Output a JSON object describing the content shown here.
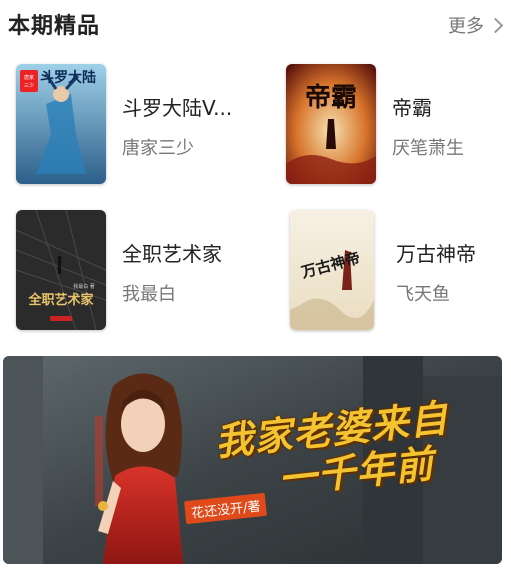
{
  "section": {
    "title": "本期精品",
    "more_label": "更多"
  },
  "books": [
    {
      "title": "斗罗大陆V...",
      "author": "唐家三少",
      "cover_text": "斗罗大陆",
      "cover_badge": "唐家三少"
    },
    {
      "title": "帝霸",
      "author": "厌笔萧生",
      "cover_text": "帝霸"
    },
    {
      "title": "全职艺术家",
      "author": "我最白",
      "cover_text": "全职艺术家",
      "cover_small": "我最白 著"
    },
    {
      "title": "万古神帝",
      "author": "飞天鱼",
      "cover_text": "万古神帝"
    }
  ],
  "banner": {
    "title_line1": "我家老婆来自",
    "title_line2": "一千年前",
    "author_tag": "花还没开/著"
  },
  "colors": {
    "title_text": "#222222",
    "muted_text": "#777777",
    "banner_gold": "#f4c430",
    "banner_tag": "#e04a1a"
  }
}
